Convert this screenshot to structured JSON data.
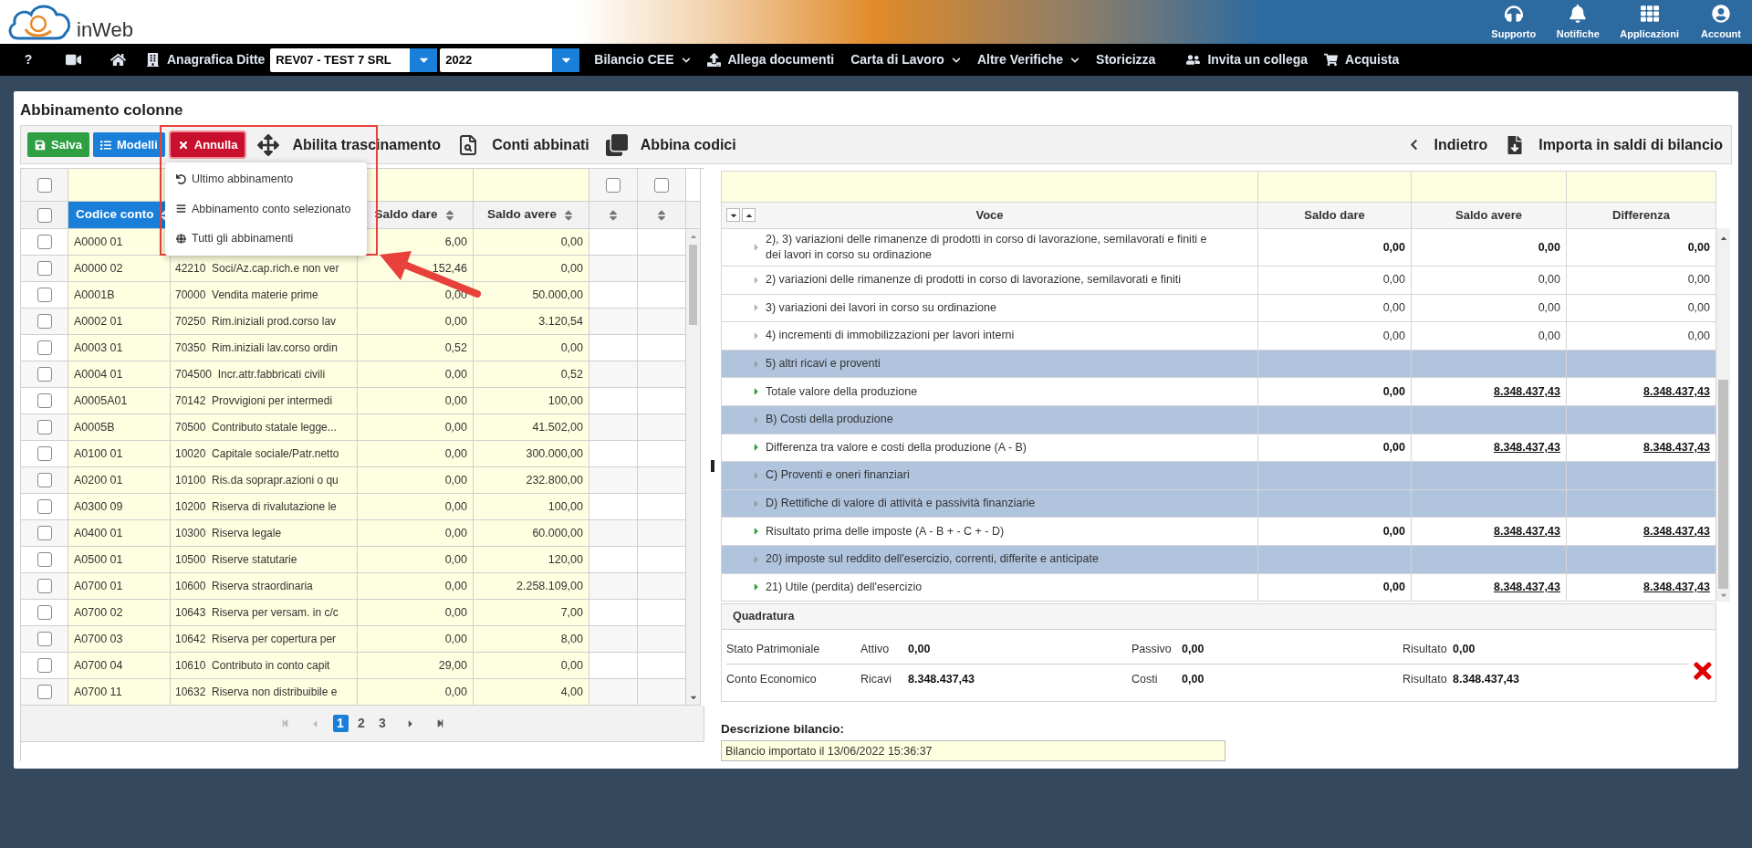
{
  "header": {
    "brand": "inWeb",
    "actions": [
      {
        "label": "Supporto",
        "kind": "headset"
      },
      {
        "label": "Notifiche",
        "kind": "bell"
      },
      {
        "label": "Applicazioni",
        "kind": "grid"
      },
      {
        "label": "Account",
        "kind": "user"
      }
    ]
  },
  "nav": {
    "help": "?",
    "company_label": "Anagrafica Ditte",
    "company": "REV07 - TEST 7 SRL",
    "year": "2022",
    "menu": [
      {
        "label": "Bilancio CEE",
        "kind": "dropdown"
      },
      {
        "label": "Allega documenti",
        "kind": "upload"
      },
      {
        "label": "Carta di Lavoro",
        "kind": "dropdown"
      },
      {
        "label": "Altre Verifiche",
        "kind": "dropdown"
      },
      {
        "label": "Storicizza",
        "kind": "plain"
      },
      {
        "label": "Invita un collega",
        "kind": "users"
      },
      {
        "label": "Acquista",
        "kind": "cart"
      }
    ]
  },
  "page_title": "Abbinamento colonne",
  "toolbar": {
    "buttons": [
      {
        "label": "Salva",
        "kind": "save"
      },
      {
        "label": "Modelli",
        "kind": "list"
      },
      {
        "label": "Annulla",
        "kind": "cancel"
      }
    ],
    "actions": [
      {
        "label": "Abilita trascinamento",
        "kind": "move"
      },
      {
        "label": "Conti abbinati",
        "kind": "search-doc"
      },
      {
        "label": "Abbina codici",
        "kind": "layers"
      }
    ],
    "right_actions": [
      {
        "label": "Indietro",
        "kind": "back"
      },
      {
        "label": "Importa in saldi di bilancio",
        "kind": "download"
      }
    ]
  },
  "undo_menu": {
    "items": [
      {
        "label": "Ultimo abbinamento",
        "kind": "undo"
      },
      {
        "label": "Abbinamento conto selezionato",
        "kind": "lines"
      },
      {
        "label": "Tutti gli abbinamenti",
        "kind": "globe"
      }
    ]
  },
  "left_table": {
    "filter_checks": [
      {
        "checked": false
      },
      {
        "checked": false
      },
      {
        "checked": false
      }
    ],
    "header_check": {
      "checked": false
    },
    "columns": [
      {
        "label": "Codice conto",
        "active": true
      },
      {},
      {
        "label": "Saldo dare",
        "active": false
      },
      {
        "label": "Saldo avere",
        "active": false
      },
      {
        "active": false
      },
      {
        "active": false
      }
    ],
    "rows": [
      {
        "checked": false,
        "code": "A0000 01",
        "dare": "6,00",
        "avere": "0,00"
      },
      {
        "checked": false,
        "code": "A0000 02",
        "description": "42210  Soci/Az.cap.rich.e non ver",
        "dare": "152,46",
        "avere": "0,00"
      },
      {
        "checked": false,
        "code": "A0001B",
        "description": "70000  Vendita materie prime",
        "dare": "0,00",
        "avere": "50.000,00"
      },
      {
        "checked": false,
        "code": "A0002 01",
        "description": "70250  Rim.iniziali prod.corso lav",
        "dare": "0,00",
        "avere": "3.120,54"
      },
      {
        "checked": false,
        "code": "A0003 01",
        "description": "70350  Rim.iniziali lav.corso ordin",
        "dare": "0,52",
        "avere": "0,00"
      },
      {
        "checked": false,
        "code": "A0004 01",
        "description": "704500  Incr.attr.fabbricati civili",
        "dare": "0,00",
        "avere": "0,52"
      },
      {
        "checked": false,
        "code": "A0005A01",
        "description": "70142  Provvigioni per intermedi",
        "dare": "0,00",
        "avere": "100,00"
      },
      {
        "checked": false,
        "code": "A0005B",
        "description": "70500  Contributo statale legge...",
        "dare": "0,00",
        "avere": "41.502,00"
      },
      {
        "checked": false,
        "code": "A0100 01",
        "description": "10020  Capitale sociale/Patr.netto",
        "dare": "0,00",
        "avere": "300.000,00"
      },
      {
        "checked": false,
        "code": "A0200 01",
        "description": "10100  Ris.da soprapr.azioni o qu",
        "dare": "0,00",
        "avere": "232.800,00"
      },
      {
        "checked": false,
        "code": "A0300 09",
        "description": "10200  Riserva di rivalutazione le",
        "dare": "0,00",
        "avere": "100,00"
      },
      {
        "checked": false,
        "code": "A0400 01",
        "description": "10300  Riserva legale",
        "dare": "0,00",
        "avere": "60.000,00"
      },
      {
        "checked": false,
        "code": "A0500 01",
        "description": "10500  Riserve statutarie",
        "dare": "0,00",
        "avere": "120,00"
      },
      {
        "checked": false,
        "code": "A0700 01",
        "description": "10600  Riserva straordinaria",
        "dare": "0,00",
        "avere": "2.258.109,00"
      },
      {
        "checked": false,
        "code": "A0700 02",
        "description": "10643  Riserva per versam. in c/c",
        "dare": "0,00",
        "avere": "7,00"
      },
      {
        "checked": false,
        "code": "A0700 03",
        "description": "10642  Riserva per copertura per",
        "dare": "0,00",
        "avere": "8,00"
      },
      {
        "checked": false,
        "code": "A0700 04",
        "description": "10610  Contributo in conto capit",
        "dare": "29,00",
        "avere": "0,00"
      },
      {
        "checked": false,
        "code": "A0700 11",
        "description": "10632  Riserva non distribuibile e",
        "dare": "0,00",
        "avere": "4,00"
      }
    ],
    "pages": [
      {
        "label": "1",
        "selected": true
      },
      {
        "label": "2",
        "selected": false
      },
      {
        "label": "3",
        "selected": false
      }
    ]
  },
  "right_table": {
    "columns": [
      "Voce",
      "Saldo dare",
      "Saldo avere",
      "Differenza"
    ],
    "voci": [
      {
        "children": [
          {
            "label": "2), 3) variazioni delle rimanenze di prodotti in corso di lavorazione, semilavorati e finiti e dei lavori in corso su ordinazione",
            "kind": "subtotal",
            "values": [
              {
                "text": "0,00",
                "underlined": false
              },
              {
                "text": "0,00",
                "underlined": false
              },
              {
                "text": "0,00",
                "underlined": false
              }
            ]
          },
          {
            "label": "2) variazioni delle rimanenze di prodotti in corso di lavorazione, semilavorati e finiti",
            "kind": "detail",
            "values": [
              {
                "text": "0,00",
                "underlined": false
              },
              {
                "text": "0,00",
                "underlined": false
              },
              {
                "text": "0,00",
                "underlined": false
              }
            ]
          },
          {
            "label": "3) variazioni dei lavori in corso su ordinazione",
            "kind": "detail",
            "values": [
              {
                "text": "0,00",
                "underlined": false
              },
              {
                "text": "0,00",
                "underlined": false
              },
              {
                "text": "0,00",
                "underlined": false
              }
            ]
          },
          {
            "label": "4) incrementi di immobilizzazioni per lavori interni",
            "kind": "detail",
            "values": [
              {
                "text": "0,00",
                "underlined": false
              },
              {
                "text": "0,00",
                "underlined": false
              },
              {
                "text": "0,00",
                "underlined": false
              }
            ]
          },
          {
            "label": "5) altri ricavi e proventi",
            "kind": "section"
          },
          {
            "label": "Totale valore della produzione",
            "kind": "total",
            "values": [
              {
                "text": "0,00",
                "underlined": false
              },
              {
                "text": "8.348.437,43",
                "underlined": true
              },
              {
                "text": "8.348.437,43",
                "underlined": true
              }
            ]
          }
        ]
      },
      {
        "label": "B) Costi della produzione",
        "kind": "section"
      },
      {
        "label": "Differenza tra valore e costi della produzione (A - B)",
        "kind": "total",
        "values": [
          {
            "text": "0,00",
            "underlined": false
          },
          {
            "text": "8.348.437,43",
            "underlined": true
          },
          {
            "text": "8.348.437,43",
            "underlined": true
          }
        ]
      },
      {
        "label": "C) Proventi e oneri finanziari",
        "kind": "section"
      },
      {
        "label": "D) Rettifiche di valore di attività e passività finanziarie",
        "kind": "section"
      },
      {
        "label": "Risultato prima delle imposte (A - B + - C + - D)",
        "kind": "total",
        "values": [
          {
            "text": "0,00",
            "underlined": false
          },
          {
            "text": "8.348.437,43",
            "underlined": true
          },
          {
            "text": "8.348.437,43",
            "underlined": true
          }
        ]
      },
      {
        "label": "20) imposte sul reddito dell'esercizio, correnti, differite e anticipate",
        "kind": "section"
      },
      {
        "label": "21) Utile (perdita) dell'esercizio",
        "kind": "total",
        "values": [
          {
            "text": "0,00",
            "underlined": false
          },
          {
            "text": "8.348.437,43",
            "underlined": true
          },
          {
            "text": "8.348.437,43",
            "underlined": true
          }
        ]
      }
    ]
  },
  "quadratura": {
    "title": "Quadratura",
    "balanced": false,
    "rows": [
      {
        "label": "Stato Patrimoniale",
        "items": [
          {
            "label": "Attivo",
            "value": "0,00"
          },
          {
            "label": "Passivo",
            "value": "0,00"
          },
          {
            "label": "Risultato",
            "value": "0,00"
          }
        ]
      },
      {
        "label": "Conto Economico",
        "items": [
          {
            "label": "Ricavi",
            "value": "8.348.437,43"
          },
          {
            "label": "Costi",
            "value": "0,00"
          },
          {
            "label": "Risultato",
            "value": "8.348.437,43"
          }
        ]
      }
    ]
  },
  "descrizione": {
    "label": "Descrizione bilancio:",
    "value": "Bilancio importato il 13/06/2022 15:36:37"
  }
}
